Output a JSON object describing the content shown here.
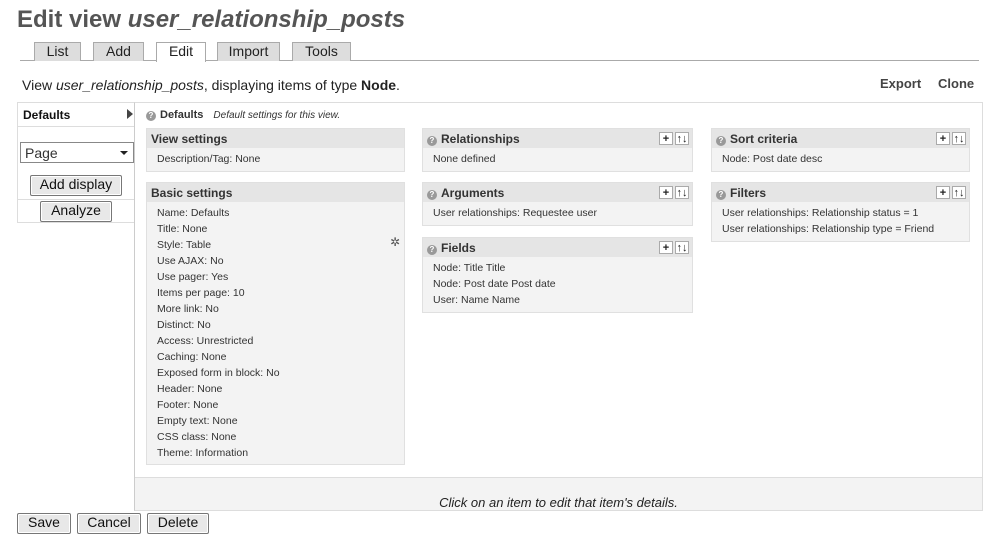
{
  "title": {
    "prefix": "Edit view ",
    "view_name": "user_relationship_posts"
  },
  "tabs": [
    "List",
    "Add",
    "Edit",
    "Import",
    "Tools"
  ],
  "active_tab": "Edit",
  "info": {
    "prefix": "View ",
    "view_name": "user_relationship_posts",
    "mid": ", displaying items of type ",
    "type": "Node",
    "suffix": "."
  },
  "top_links": {
    "export": "Export",
    "clone": "Clone"
  },
  "displays": {
    "current": "Defaults",
    "select_value": "Page",
    "add_display": "Add display",
    "analyze": "Analyze"
  },
  "main": {
    "header_title": "Defaults",
    "header_desc": "Default settings for this view.",
    "footer_message": "Click on an item to edit that item's details."
  },
  "panels": {
    "view_settings": {
      "title": "View settings",
      "rows": [
        "Description/Tag: None"
      ]
    },
    "basic_settings": {
      "title": "Basic settings",
      "rows": [
        "Name: Defaults",
        "Title: None",
        "Style: Table",
        "Use AJAX: No",
        "Use pager: Yes",
        "Items per page: 10",
        "More link: No",
        "Distinct: No",
        "Access: Unrestricted",
        "Caching: None",
        "Exposed form in block: No",
        "Header: None",
        "Footer: None",
        "Empty text: None",
        "CSS class: None",
        "Theme: Information"
      ]
    },
    "relationships": {
      "title": "Relationships",
      "rows": [
        "None defined"
      ]
    },
    "arguments": {
      "title": "Arguments",
      "rows": [
        "User relationships: Requestee user"
      ]
    },
    "fields": {
      "title": "Fields",
      "rows": [
        "Node: Title Title",
        "Node: Post date Post date",
        "User: Name Name"
      ]
    },
    "sort_criteria": {
      "title": "Sort criteria",
      "rows": [
        "Node: Post date desc"
      ]
    },
    "filters": {
      "title": "Filters",
      "rows": [
        "User relationships: Relationship status = 1",
        "User relationships: Relationship type = Friend"
      ]
    }
  },
  "icons": {
    "help": "?",
    "add": "+",
    "rearrange": "↑↓",
    "gear": "✲"
  },
  "buttons": {
    "save": "Save",
    "cancel": "Cancel",
    "delete": "Delete"
  }
}
